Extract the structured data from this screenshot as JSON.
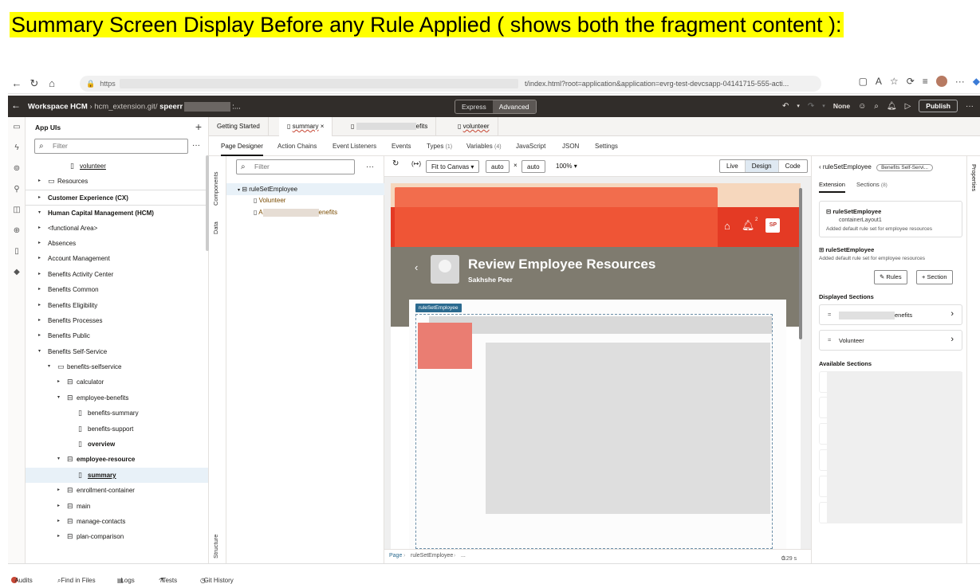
{
  "caption": "Summary Screen Display Before any Rule Applied ( shows both the fragment content ):",
  "browser": {
    "url_prefix": "https",
    "url_tail": "t/index.html?root=application&application=evrg-test-devcsapp-04141715-555-acti..."
  },
  "header": {
    "back": "←",
    "workspace": "Workspace HCM",
    "sep": "›",
    "repo": "hcm_extension.git/",
    "user": "speerr",
    "ellipsis": ":...",
    "mode_express": "Express",
    "mode_advanced": "Advanced",
    "none_label": "None",
    "publish": "Publish"
  },
  "nav": {
    "title": "App UIs",
    "filter_placeholder": "Filter",
    "rows": [
      {
        "label": "volunteer",
        "indent": 44,
        "twisty": "",
        "icon": "page",
        "style": "underline"
      },
      {
        "label": "Resources",
        "indent": 16,
        "twisty": "▸",
        "icon": "folder",
        "style": ""
      },
      {
        "label": "Customer Experience (CX)",
        "indent": 16,
        "twisty": "▸",
        "icon": "",
        "style": "bold sep"
      },
      {
        "label": "Human Capital Management (HCM)",
        "indent": 16,
        "twisty": "▾",
        "icon": "",
        "style": "bold sep"
      },
      {
        "label": "<functional Area>",
        "indent": 16,
        "twisty": "▸",
        "icon": "",
        "style": ""
      },
      {
        "label": "Absences",
        "indent": 16,
        "twisty": "▸",
        "icon": "",
        "style": ""
      },
      {
        "label": "Account Management",
        "indent": 16,
        "twisty": "▸",
        "icon": "",
        "style": ""
      },
      {
        "label": "Benefits Activity Center",
        "indent": 16,
        "twisty": "▸",
        "icon": "",
        "style": ""
      },
      {
        "label": "Benefits Common",
        "indent": 16,
        "twisty": "▸",
        "icon": "",
        "style": ""
      },
      {
        "label": "Benefits Eligibility",
        "indent": 16,
        "twisty": "▸",
        "icon": "",
        "style": ""
      },
      {
        "label": "Benefits Processes",
        "indent": 16,
        "twisty": "▸",
        "icon": "",
        "style": ""
      },
      {
        "label": "Benefits Public",
        "indent": 16,
        "twisty": "▸",
        "icon": "",
        "style": ""
      },
      {
        "label": "Benefits Self-Service",
        "indent": 16,
        "twisty": "▾",
        "icon": "",
        "style": ""
      },
      {
        "label": "benefits-selfservice",
        "indent": 28,
        "twisty": "▾",
        "icon": "app",
        "style": ""
      },
      {
        "label": "calculator",
        "indent": 40,
        "twisty": "▸",
        "icon": "flow",
        "style": ""
      },
      {
        "label": "employee-benefits",
        "indent": 40,
        "twisty": "▾",
        "icon": "flow",
        "style": ""
      },
      {
        "label": "benefits-summary",
        "indent": 54,
        "twisty": "",
        "icon": "page",
        "style": ""
      },
      {
        "label": "benefits-support",
        "indent": 54,
        "twisty": "",
        "icon": "page",
        "style": ""
      },
      {
        "label": "overview",
        "indent": 54,
        "twisty": "",
        "icon": "page",
        "style": "bold"
      },
      {
        "label": "employee-resource",
        "indent": 40,
        "twisty": "▾",
        "icon": "flow",
        "style": "bold"
      },
      {
        "label": "summary",
        "indent": 54,
        "twisty": "",
        "icon": "page",
        "style": "bold underline sel"
      },
      {
        "label": "enrollment-container",
        "indent": 40,
        "twisty": "▸",
        "icon": "flow",
        "style": ""
      },
      {
        "label": "main",
        "indent": 40,
        "twisty": "▸",
        "icon": "flow",
        "style": ""
      },
      {
        "label": "manage-contacts",
        "indent": 40,
        "twisty": "▸",
        "icon": "flow",
        "style": ""
      },
      {
        "label": "plan-comparison",
        "indent": 40,
        "twisty": "▸",
        "icon": "flow",
        "style": ""
      }
    ]
  },
  "tabs": {
    "getting_started": "Getting Started",
    "summary": "summary",
    "close": "×",
    "efits_suffix": "efits",
    "volunteer": "volunteer"
  },
  "subtabs": {
    "page_designer": "Page Designer",
    "action_chains": "Action Chains",
    "event_listeners": "Event Listeners",
    "events": "Events",
    "types": "Types",
    "types_count": "(1)",
    "variables": "Variables",
    "variables_count": "(4)",
    "javascript": "JavaScript",
    "json": "JSON",
    "settings": "Settings"
  },
  "strip": {
    "components": "Components",
    "data": "Data",
    "structure": "Structure"
  },
  "structure": {
    "filter_placeholder": "Filter",
    "root": "ruleSetEmployee",
    "child1": "Volunteer",
    "child2_prefix": "A",
    "child2_suffix": "enefits"
  },
  "canvas_toolbar": {
    "fit": "Fit to Canvas",
    "w": "auto",
    "x": "×",
    "h": "auto",
    "zoom": "100%",
    "live": "Live",
    "design": "Design",
    "code": "Code"
  },
  "device": {
    "notif_count": "2",
    "avatar": "SP",
    "title": "Review Employee Resources",
    "subtitle": "Sakhshe Peer",
    "ruleset_label": "ruleSetEmployee"
  },
  "statusbar": {
    "page": "Page",
    "ruleset": "ruleSetEmployee",
    "more": "...",
    "timing": "0.29 s"
  },
  "props": {
    "head": "ruleSetEmployee",
    "badge": "Benefits Self-Servi...",
    "tab_extension": "Extension",
    "tab_sections": "Sections",
    "tab_sections_count": "(8)",
    "card_title": "ruleSetEmployee",
    "card_layout": "containerLayout1",
    "card_desc": "Added default rule set for employee resources",
    "name": "ruleSetEmployee",
    "desc": "Added default rule set for employee resources",
    "rules_btn": "Rules",
    "section_btn": "Section",
    "displayed": "Displayed Sections",
    "sec1_suffix": "enefits",
    "sec2": "Volunteer",
    "available": "Available Sections",
    "rail": "Properties"
  },
  "bottom": {
    "audits": "Audits",
    "find": "Find in Files",
    "logs": "Logs",
    "tests": "Tests",
    "git": "Git History"
  }
}
